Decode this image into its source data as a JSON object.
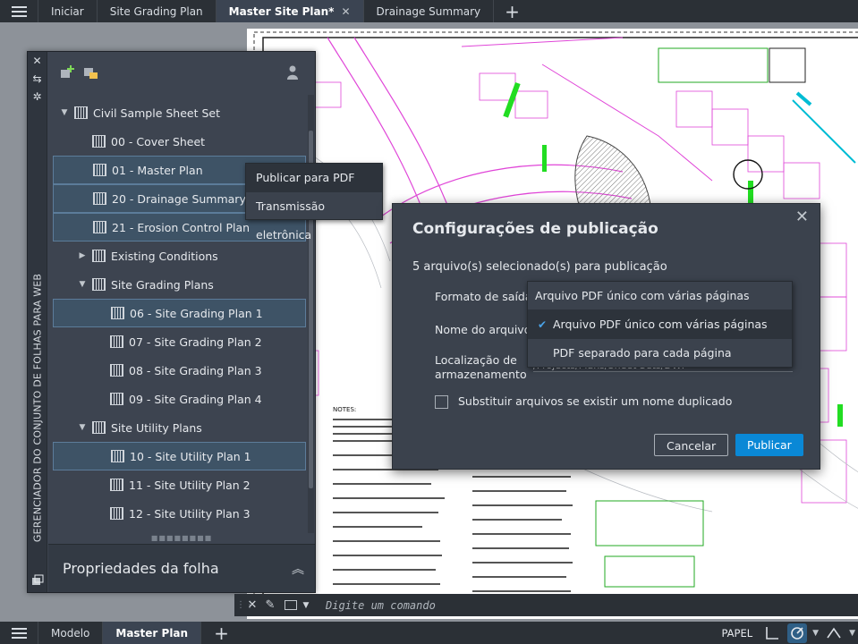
{
  "tabs": [
    "Iniciar",
    "Site Grading Plan",
    "Master Site Plan*",
    "Drainage Summary"
  ],
  "ssm": {
    "vertical_title": "GERENCIADOR DO CONJUNTO DE FOLHAS PARA WEB",
    "properties_label": "Propriedades da folha",
    "tree": [
      {
        "label": "Civil Sample Sheet Set",
        "type": "root",
        "level": 0,
        "selected": false
      },
      {
        "label": "00 - Cover Sheet",
        "type": "sheet",
        "level": 1,
        "selected": false
      },
      {
        "label": "01 - Master Plan",
        "type": "sheet",
        "level": 1,
        "selected": true
      },
      {
        "label": "20 - Drainage Summary",
        "type": "sheet",
        "level": 1,
        "selected": true
      },
      {
        "label": "21 - Erosion Control Plan",
        "type": "sheet",
        "level": 1,
        "selected": true
      },
      {
        "label": "Existing Conditions",
        "type": "group-collapsed",
        "level": 1,
        "selected": false
      },
      {
        "label": "Site Grading Plans",
        "type": "group",
        "level": 1,
        "selected": false
      },
      {
        "label": "06 - Site Grading Plan 1",
        "type": "sheet",
        "level": 2,
        "selected": true
      },
      {
        "label": "07 - Site Grading Plan 2",
        "type": "sheet",
        "level": 2,
        "selected": false
      },
      {
        "label": "08 - Site Grading Plan 3",
        "type": "sheet",
        "level": 2,
        "selected": false
      },
      {
        "label": "09 - Site Grading Plan 4",
        "type": "sheet",
        "level": 2,
        "selected": false
      },
      {
        "label": "Site Utility Plans",
        "type": "group",
        "level": 1,
        "selected": false
      },
      {
        "label": "10 - Site Utility Plan 1",
        "type": "sheet",
        "level": 2,
        "selected": true
      },
      {
        "label": "11 - Site Utility Plan 2",
        "type": "sheet",
        "level": 2,
        "selected": false
      },
      {
        "label": "12 - Site Utility Plan 3",
        "type": "sheet",
        "level": 2,
        "selected": false
      }
    ]
  },
  "context_menu": {
    "items": [
      "Publicar para PDF",
      "Transmissão eletrônica"
    ]
  },
  "dialog": {
    "title": "Configurações de publicação",
    "subtitle": "5 arquivo(s) selecionado(s) para publicação",
    "output_format_label": "Formato de saída",
    "filename_label": "Nome do arquivo",
    "location_label": "Localização de armazenamento",
    "location_value": "/Projects/Plans/Sheet Sets/DWF",
    "replace_checkbox_label": "Substituir arquivos se existir um nome duplicado",
    "replace_checked": false,
    "cancel_label": "Cancelar",
    "publish_label": "Publicar"
  },
  "dropdown": {
    "current": "Arquivo PDF único com várias páginas",
    "options": [
      "Arquivo PDF único com várias páginas",
      "PDF separado para cada página"
    ],
    "selected_option": "Arquivo PDF único com várias páginas"
  },
  "command_line": {
    "placeholder": "Digite um comando"
  },
  "bottom_tabs": [
    "Modelo",
    "Master Plan"
  ],
  "status": {
    "space_label": "PAPEL"
  },
  "colors": {
    "accent": "#0a88d6",
    "panel": "#3b424d",
    "selection": "#3e5366"
  }
}
